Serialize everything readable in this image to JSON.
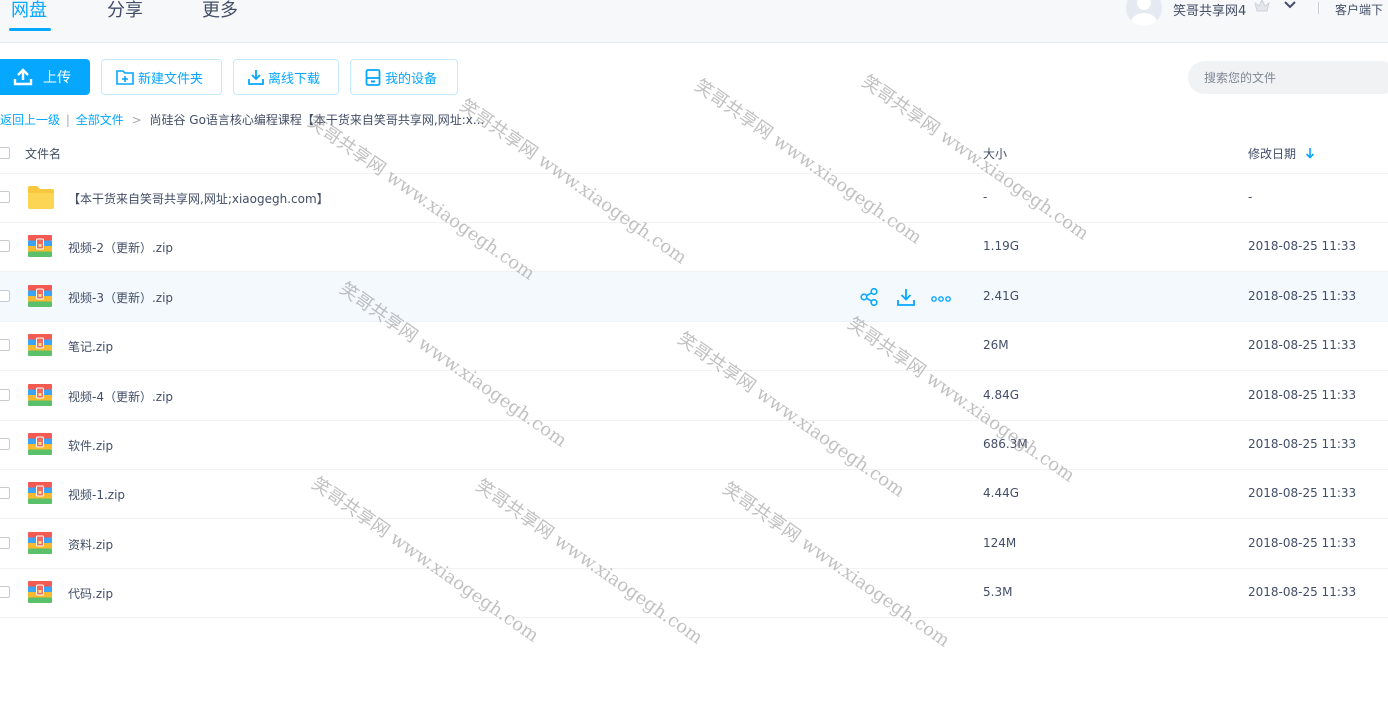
{
  "nav": {
    "tabs": [
      {
        "label": "网盘",
        "active": true
      },
      {
        "label": "分享",
        "active": false
      },
      {
        "label": "更多",
        "active": false
      }
    ]
  },
  "user": {
    "name": "笑哥共享网4",
    "client_link": "客户端下"
  },
  "toolbar": {
    "upload_label": "上传",
    "new_folder_label": "新建文件夹",
    "offline_download_label": "离线下载",
    "my_devices_label": "我的设备"
  },
  "search": {
    "placeholder": "搜索您的文件"
  },
  "breadcrumb": {
    "back": "返回上一级",
    "divider": "|",
    "all_files": "全部文件",
    "arrow": ">",
    "current": "尚硅谷 Go语言核心编程课程【本干货来自笑哥共享网,网址:x..."
  },
  "table": {
    "headers": {
      "name": "文件名",
      "size": "大小",
      "date": "修改日期"
    },
    "sort_indicator": "date-desc",
    "rows": [
      {
        "name": "【本干货来自笑哥共享网,网址;xiaogegh.com】",
        "type": "folder",
        "size": "-",
        "date": "-"
      },
      {
        "name": "视频-2（更新）.zip",
        "type": "zip",
        "size": "1.19G",
        "date": "2018-08-25 11:33"
      },
      {
        "name": "视频-3（更新）.zip",
        "type": "zip",
        "size": "2.41G",
        "date": "2018-08-25 11:33",
        "hovered": true
      },
      {
        "name": "笔记.zip",
        "type": "zip",
        "size": "26M",
        "date": "2018-08-25 11:33"
      },
      {
        "name": "视频-4（更新）.zip",
        "type": "zip",
        "size": "4.84G",
        "date": "2018-08-25 11:33"
      },
      {
        "name": "软件.zip",
        "type": "zip",
        "size": "686.3M",
        "date": "2018-08-25 11:33"
      },
      {
        "name": "视频-1.zip",
        "type": "zip",
        "size": "4.44G",
        "date": "2018-08-25 11:33"
      },
      {
        "name": "资料.zip",
        "type": "zip",
        "size": "124M",
        "date": "2018-08-25 11:33"
      },
      {
        "name": "代码.zip",
        "type": "zip",
        "size": "5.3M",
        "date": "2018-08-25 11:33"
      }
    ]
  },
  "row_actions": [
    "share-icon",
    "download-icon",
    "more-icon"
  ],
  "watermark_text": "笑哥共享网 www.xiaogegh.com",
  "colors": {
    "accent": "#06a7ff",
    "text": "#424e67",
    "hover_row": "#f4f9fe"
  }
}
